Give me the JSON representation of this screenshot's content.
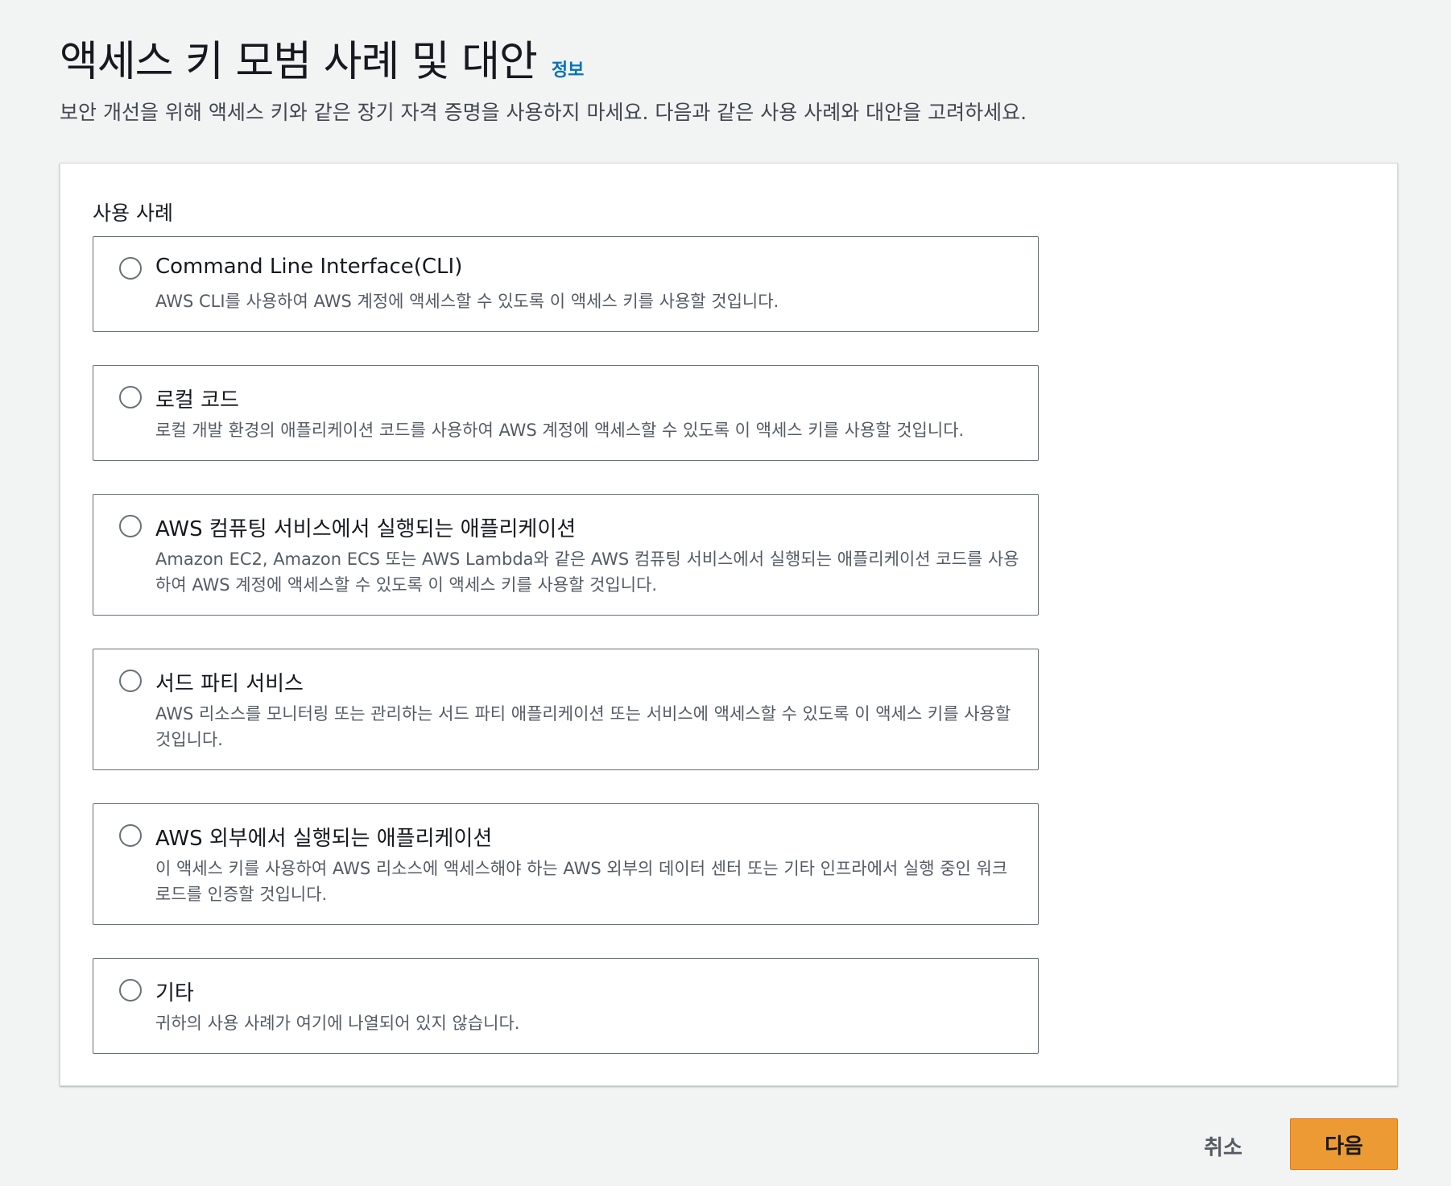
{
  "header": {
    "title": "액세스 키 모범 사례 및 대안",
    "info_link": "정보",
    "subtitle": "보안 개선을 위해 액세스 키와 같은 장기 자격 증명을 사용하지 마세요. 다음과 같은 사용 사례와 대안을 고려하세요."
  },
  "use_cases": {
    "label": "사용 사례",
    "selected": null,
    "options": [
      {
        "title": "Command Line Interface(CLI)",
        "description": "AWS CLI를 사용하여 AWS 계정에 액세스할 수 있도록 이 액세스 키를 사용할 것입니다."
      },
      {
        "title": "로컬 코드",
        "description": "로컬 개발 환경의 애플리케이션 코드를 사용하여 AWS 계정에 액세스할 수 있도록 이 액세스 키를 사용할 것입니다."
      },
      {
        "title": "AWS 컴퓨팅 서비스에서 실행되는 애플리케이션",
        "description": "Amazon EC2, Amazon ECS 또는 AWS Lambda와 같은 AWS 컴퓨팅 서비스에서 실행되는 애플리케이션 코드를 사용하여 AWS 계정에 액세스할 수 있도록 이 액세스 키를 사용할 것입니다."
      },
      {
        "title": "서드 파티 서비스",
        "description": "AWS 리소스를 모니터링 또는 관리하는 서드 파티 애플리케이션 또는 서비스에 액세스할 수 있도록 이 액세스 키를 사용할 것입니다."
      },
      {
        "title": "AWS 외부에서 실행되는 애플리케이션",
        "description": "이 액세스 키를 사용하여 AWS 리소스에 액세스해야 하는 AWS 외부의 데이터 센터 또는 기타 인프라에서 실행 중인 워크로드를 인증할 것입니다."
      },
      {
        "title": "기타",
        "description": "귀하의 사용 사례가 여기에 나열되어 있지 않습니다."
      }
    ]
  },
  "footer": {
    "cancel_label": "취소",
    "next_label": "다음"
  },
  "colors": {
    "background": "#f2f3f3",
    "link": "#0073bb",
    "primary_button": "#ec9a33",
    "border": "#687078"
  }
}
